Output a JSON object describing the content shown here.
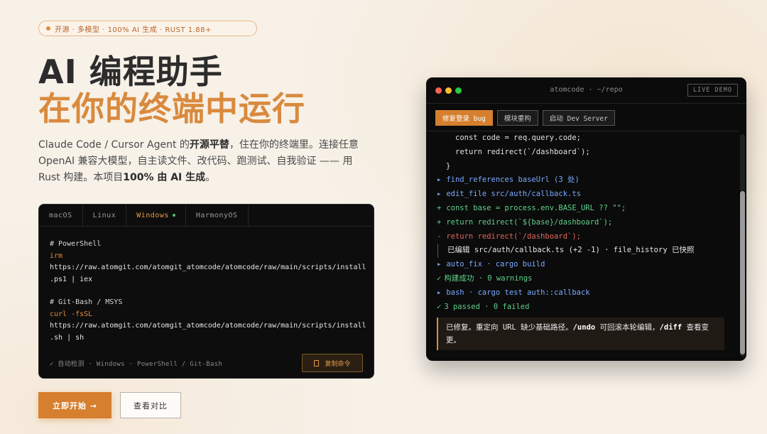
{
  "badge": {
    "text": "开源 · 多模型 · 100% AI 生成 · RUST 1.88+",
    "dot_color": "#e68a3d"
  },
  "hero": {
    "line1": "AI 编程助手",
    "line2": "在你的终端中运行",
    "desc_p1": "Claude Code / Cursor Agent 的",
    "desc_b1": "开源平替",
    "desc_p2": "，住在你的终端里。连接任意 OpenAI 兼容大模型，自主读文件、改代码、跑测试、自我验证 —— 用 Rust 构建。本项目",
    "desc_b2": "100% 由 AI 生成",
    "desc_p3": "。"
  },
  "install": {
    "tabs": [
      "macOS",
      "Linux",
      "Windows",
      "HarmonyOS"
    ],
    "active_tab": "Windows",
    "lines": {
      "c1": "# PowerShell",
      "k1": "irm",
      "u1a": "https://raw.atomgit.com/atomgit_atomcode/atomcode/raw/main/scripts/install",
      "u1b": ".ps1 | iex",
      "c2": "# Git-Bash / MSYS",
      "k2": "curl -fsSL",
      "u2a": "https://raw.atomgit.com/atomgit_atomcode/atomcode/raw/main/scripts/install",
      "u2b": ".sh | sh"
    },
    "detect": "✓ 自动检测 · Windows · PowerShell / Git-Bash",
    "copy_label": "复制命令"
  },
  "cta": {
    "primary": "立即开始 →",
    "secondary": "查看对比"
  },
  "demo": {
    "title": "atomcode · ~/repo",
    "live": "LIVE DEMO",
    "buttons": [
      "修复登录 bug",
      "模块重构",
      "启动 Dev Server"
    ],
    "active_button": "修复登录 bug",
    "l1": "const code = req.query.code;",
    "l2": "return redirect(`/dashboard`);",
    "l3": "}",
    "l4": "find_references baseUrl (3 处)",
    "l5": "edit_file src/auth/callback.ts",
    "l6": "const base = process.env.BASE_URL ?? \"\";",
    "l7": "return redirect(`${base}/dashboard`);",
    "l8": "return redirect(`/dashboard`);",
    "l9": "已编辑 src/auth/callback.ts (+2 -1) · file_history 已快照",
    "l10": "auto_fix · cargo build",
    "l11": "构建成功 · 0 warnings",
    "l12": "bash · cargo test auth::callback",
    "l13": "3 passed · 0 failed",
    "fix_p1": "已修复。重定向 URL 缺少基础路径。",
    "fix_b1": "/undo",
    "fix_p2": " 可回滚本轮编辑，",
    "fix_b2": "/diff",
    "fix_p3": " 查看变更。"
  },
  "colors": {
    "accent": "#d67f2e",
    "title_orange": "#d98a3e",
    "term_bg": "#0b0b0b"
  }
}
